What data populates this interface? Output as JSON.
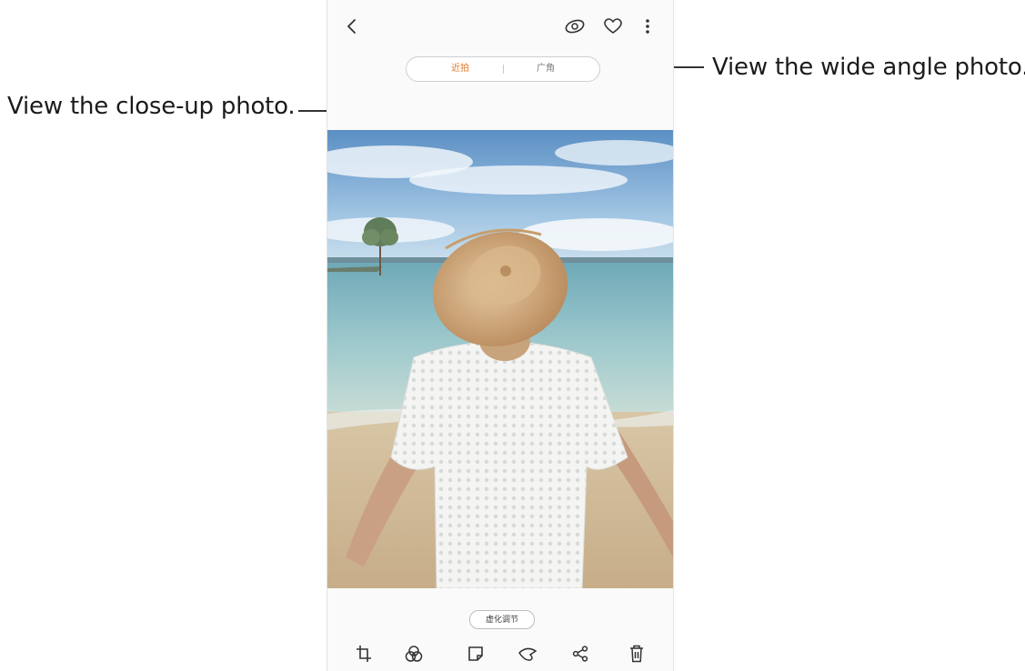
{
  "annotations": {
    "close_up": "View the close-up photo.",
    "wide_angle": "View the wide angle photo."
  },
  "top_bar": {
    "back_icon": "chevron-left-icon",
    "icons": [
      "dual-lens-icon",
      "heart-icon",
      "more-vertical-icon"
    ]
  },
  "lens_toggle": {
    "close_up_label": "近拍",
    "wide_label": "广角",
    "selected": "close_up",
    "accent_color": "#e07b2a"
  },
  "adjust_button": {
    "label": "虚化调节"
  },
  "bottom_bar": {
    "icons": [
      "crop-rotate-icon",
      "filter-icon",
      "sticker-icon",
      "decorate-icon",
      "share-icon",
      "delete-icon"
    ]
  }
}
